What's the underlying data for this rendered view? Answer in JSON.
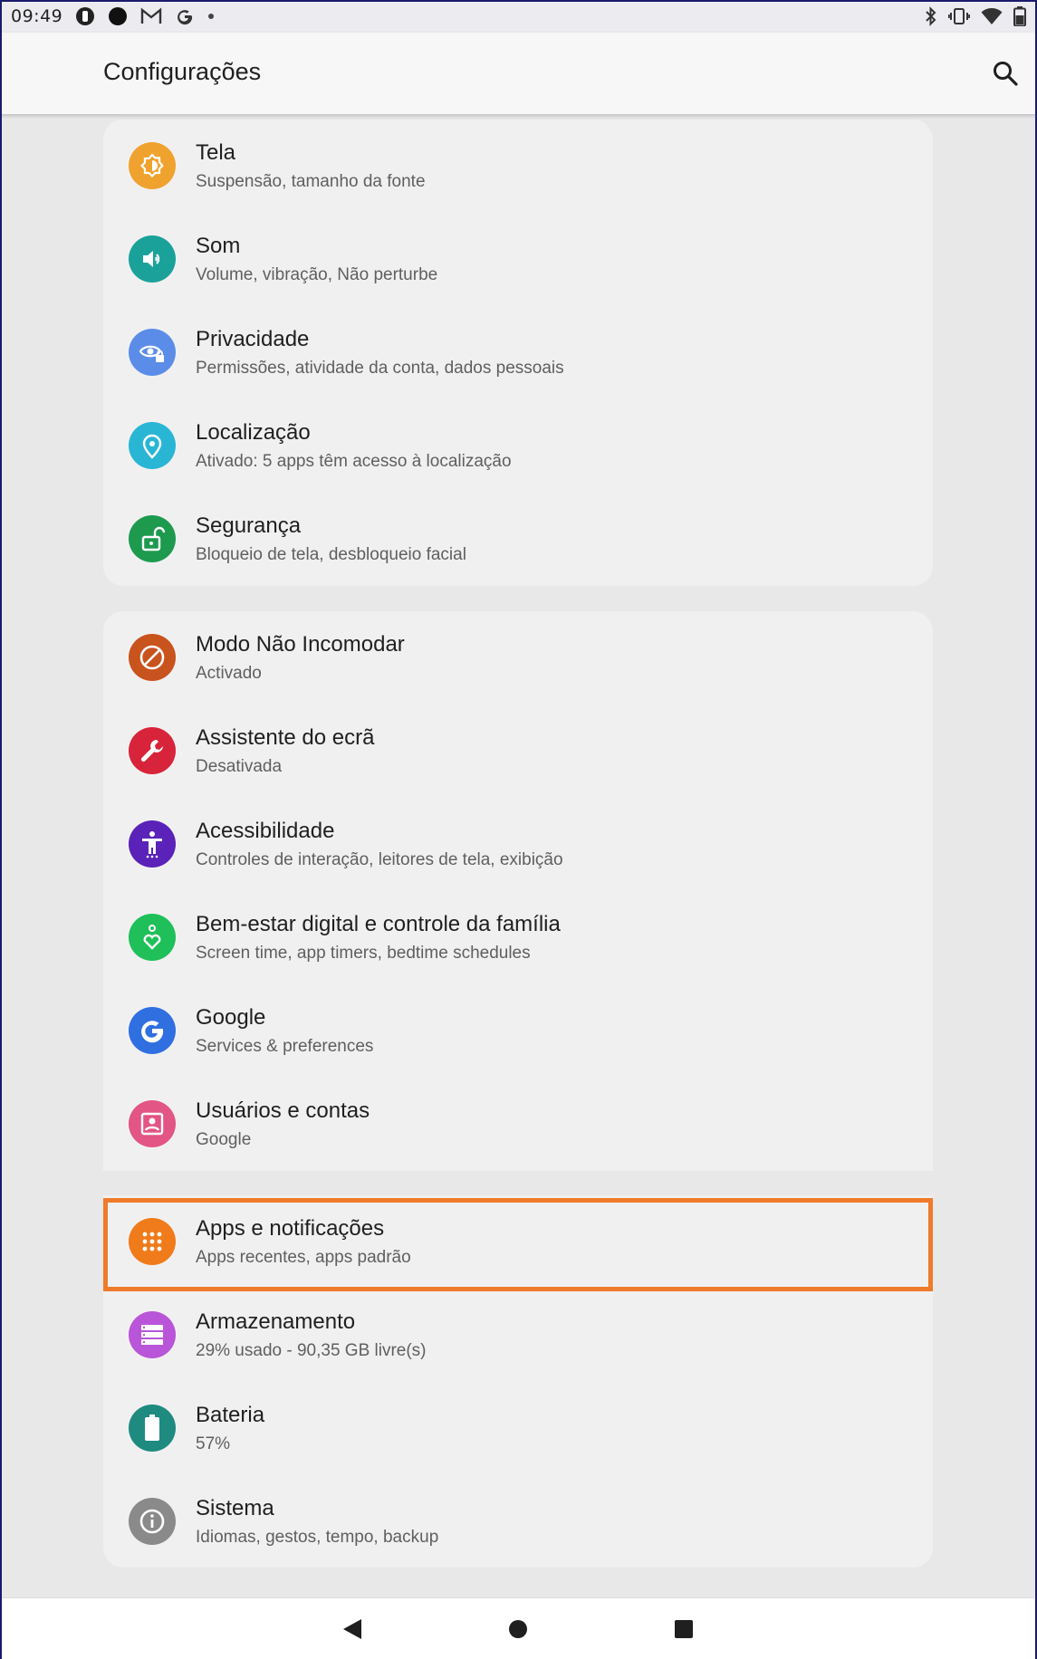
{
  "status_bar": {
    "time": "09:49",
    "left_icons": [
      "sim-icon",
      "circle-icon",
      "gmail-icon",
      "google-icon",
      "dot-icon"
    ],
    "right_icons": [
      "bluetooth-icon",
      "vibrate-icon",
      "wifi-icon",
      "battery-icon"
    ]
  },
  "app_bar": {
    "title": "Configurações",
    "search_icon": "search-icon"
  },
  "groups": [
    {
      "items": [
        {
          "title": "Tela",
          "subtitle": "Suspensão, tamanho da fonte",
          "icon": "brightness-icon",
          "color": "#f0a22e"
        },
        {
          "title": "Som",
          "subtitle": "Volume, vibração, Não perturbe",
          "icon": "volume-icon",
          "color": "#1aa29a"
        },
        {
          "title": "Privacidade",
          "subtitle": "Permissões, atividade da conta, dados pessoais",
          "icon": "privacy-eye-icon",
          "color": "#5b8de8"
        },
        {
          "title": "Localização",
          "subtitle": "Ativado: 5 apps têm acesso à localização",
          "icon": "location-pin-icon",
          "color": "#29b6d4"
        },
        {
          "title": "Segurança",
          "subtitle": "Bloqueio de tela, desbloqueio facial",
          "icon": "lock-open-icon",
          "color": "#1e9a4f"
        }
      ]
    },
    {
      "items": [
        {
          "title": "Modo Não Incomodar",
          "subtitle": "Activado",
          "icon": "do-not-disturb-icon",
          "color": "#c8531d"
        },
        {
          "title": "Assistente do ecrã",
          "subtitle": "Desativada",
          "icon": "wrench-icon",
          "color": "#d8243a"
        },
        {
          "title": "Acessibilidade",
          "subtitle": "Controles de interação, leitores de tela, exibição",
          "icon": "accessibility-icon",
          "color": "#5a22b8"
        },
        {
          "title": "Bem-estar digital e controle da família",
          "subtitle": "Screen time, app timers, bedtime schedules",
          "icon": "wellbeing-heart-icon",
          "color": "#1fbf5a"
        },
        {
          "title": "Google",
          "subtitle": "Services & preferences",
          "icon": "google-g-icon",
          "color": "#2f6fe0"
        },
        {
          "title": "Usuários e contas",
          "subtitle": "Google",
          "icon": "account-box-icon",
          "color": "#e25584"
        }
      ]
    },
    {
      "items": [
        {
          "title": "Apps e notificações",
          "subtitle": "Apps recentes, apps padrão",
          "icon": "apps-grid-icon",
          "color": "#f07b1a"
        },
        {
          "title": "Armazenamento",
          "subtitle": "29% usado - 90,35 GB livre(s)",
          "icon": "storage-icon",
          "color": "#b955d8"
        },
        {
          "title": "Bateria",
          "subtitle": "57%",
          "icon": "battery-full-icon",
          "color": "#1f8a80"
        },
        {
          "title": "Sistema",
          "subtitle": "Idiomas, gestos, tempo, backup",
          "icon": "info-icon",
          "color": "#8a8a8a"
        }
      ]
    }
  ],
  "highlight_color": "#f07b2a",
  "nav_bar": {
    "buttons": [
      "back-icon",
      "home-icon",
      "recents-icon"
    ]
  }
}
